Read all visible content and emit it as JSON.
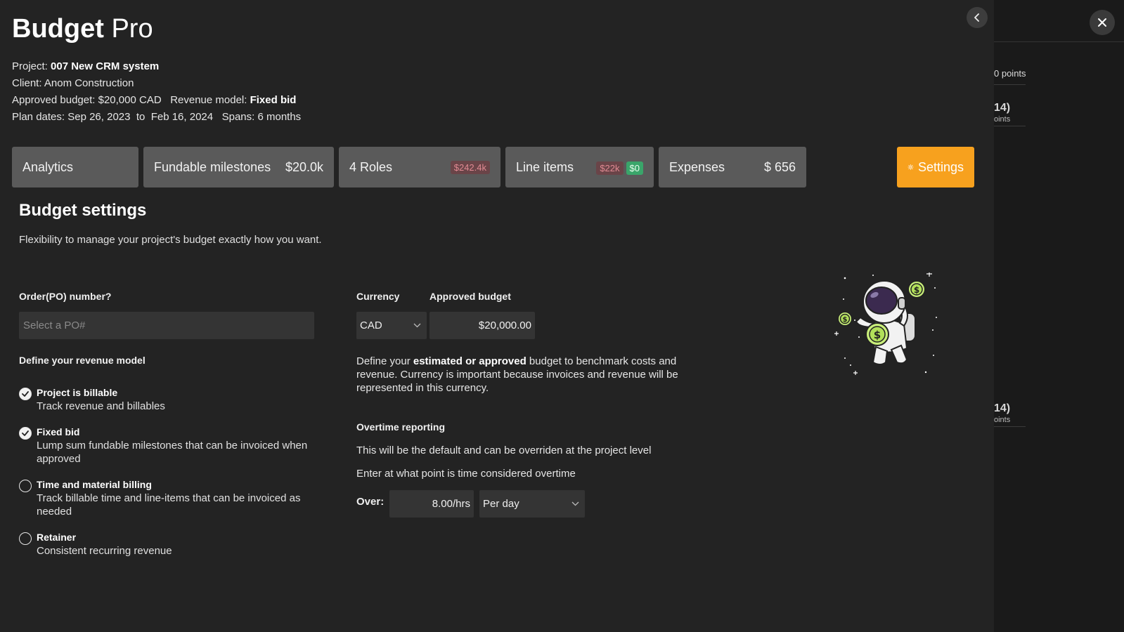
{
  "app": {
    "title_bold": "Budget",
    "title_light": "Pro"
  },
  "project": {
    "label": "Project:",
    "name": "007 New CRM system",
    "client_label": "Client:",
    "client": "Anom Construction",
    "budget_label": "Approved budget:",
    "budget": "$20,000 CAD",
    "revenue_label": "Revenue model:",
    "revenue_model": "Fixed bid",
    "plan_label": "Plan dates:",
    "start": "Sep 26, 2023",
    "to": "to",
    "end": "Feb 16, 2024",
    "spans_label": "Spans:",
    "spans": "6 months"
  },
  "tabs": {
    "analytics": "Analytics",
    "milestones": {
      "label": "Fundable milestones",
      "value": "$20.0k"
    },
    "roles": {
      "label": "4 Roles",
      "badge": "$242.4k"
    },
    "line_items": {
      "label": "Line items",
      "badge": "$22k",
      "badge2": "$0"
    },
    "expenses": {
      "label": "Expenses",
      "value": "$ 656"
    },
    "settings": "Settings"
  },
  "settings": {
    "title": "Budget settings",
    "subtitle": "Flexibility to manage your project's budget exactly how you want.",
    "po_label": "Order(PO) number?",
    "po_placeholder": "Select a PO#",
    "revenue_title": "Define your revenue model",
    "revenue_options": [
      {
        "title": "Project is billable",
        "desc": "Track revenue and billables",
        "checked": true
      },
      {
        "title": "Fixed bid",
        "desc": "Lump sum fundable milestones that can be invoiced when approved",
        "checked": true
      },
      {
        "title": "Time and material billing",
        "desc": "Track billable time and line-items that can be invoiced as needed",
        "checked": false
      },
      {
        "title": "Retainer",
        "desc": "Consistent recurring revenue",
        "checked": false
      }
    ],
    "currency_label": "Currency",
    "currency": "CAD",
    "approved_label": "Approved budget",
    "approved_value": "$20,000.00",
    "desc_pre": "Define your ",
    "desc_bold": "estimated or approved",
    "desc_post": " budget to benchmark costs and revenue. Currency is important because invoices and revenue will be represented in this currency.",
    "overtime_title": "Overtime reporting",
    "overtime_line1": "This will be the default and can be overriden at the project level",
    "overtime_line2": "Enter at what point is time considered overtime",
    "over_label": "Over:",
    "over_value": "8.00/hrs",
    "period": "Per day"
  },
  "background": {
    "points_1": "0 points",
    "item_2_big": "14)",
    "item_2_small": "oints",
    "item_3_big": "14)",
    "item_3_small": "oints"
  },
  "colors": {
    "accent": "#f7a11e",
    "panel": "#232323",
    "tab": "#5a5a5a"
  },
  "icons": [
    "close-icon",
    "chevron-left-icon",
    "gear-icon",
    "chevron-down-icon",
    "check-icon",
    "astronaut-illustration"
  ]
}
